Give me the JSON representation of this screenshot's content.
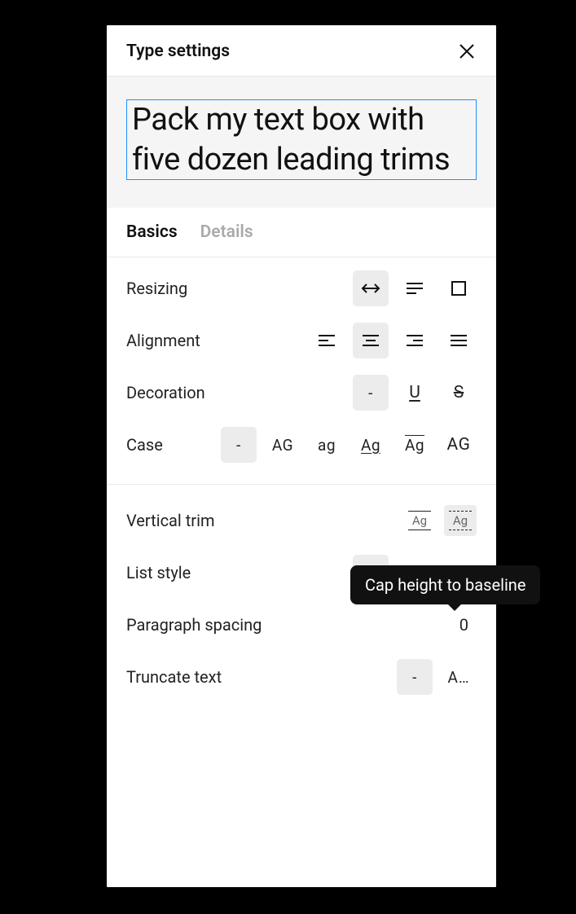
{
  "header": {
    "title": "Type settings"
  },
  "preview": {
    "text": "Pack my text box with five dozen leading trims"
  },
  "tabs": {
    "basics": "Basics",
    "details": "Details"
  },
  "rows": {
    "resizing": "Resizing",
    "alignment": "Alignment",
    "decoration": "Decoration",
    "case": "Case",
    "vertical_trim": "Vertical trim",
    "list_style": "List style",
    "paragraph_spacing": "Paragraph spacing",
    "truncate_text": "Truncate text"
  },
  "options": {
    "decoration_none": "-",
    "decoration_underline": "U",
    "decoration_strike": "S",
    "case_none": "-",
    "case_upper": "AG",
    "case_lower": "ag",
    "case_title": "Ag",
    "case_forced": "Ag",
    "case_small": "AG",
    "vtrim_label": "Ag",
    "list_none": "-",
    "truncate_none": "-",
    "truncate_on": "A…"
  },
  "values": {
    "paragraph_spacing": "0"
  },
  "tooltip": "Cap height to baseline"
}
